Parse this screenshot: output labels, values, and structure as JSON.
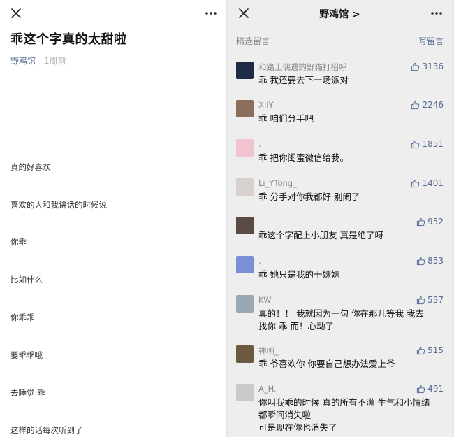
{
  "left": {
    "article_title": "乖这个字真的太甜啦",
    "author": "野鸡馆",
    "time": "1周前",
    "lines": [
      "真的好喜欢",
      "喜欢的人和我讲话的时候说",
      "你乖",
      "比如什么",
      "你乖乖",
      "要乖乖哦",
      "去睡觉 乖",
      "这样的话每次听到了"
    ]
  },
  "right": {
    "title": "野鸡馆 >",
    "section_label": "精选留言",
    "write_label": "写留言",
    "comments": [
      {
        "nick": "和路上偶遇的野猫打招呼",
        "text": "乖 我还要去下一场派对",
        "likes": "3136",
        "avatar_color": "#1f2a44"
      },
      {
        "nick": "XIIY",
        "text": "乖 咱们分手吧",
        "likes": "2246",
        "avatar_color": "#8b6f5c"
      },
      {
        "nick": ".",
        "text": "乖 把你闺蜜微信给我。",
        "likes": "1851",
        "avatar_color": "#f2c4cf"
      },
      {
        "nick": "Li_YTong_",
        "text": "乖 分手对你我都好 别闹了",
        "likes": "1401",
        "avatar_color": "#d8d0cc"
      },
      {
        "nick": "",
        "text": "乖这个字配上小朋友 真是绝了呀",
        "likes": "952",
        "avatar_color": "#5a4a45"
      },
      {
        "nick": ".",
        "text": "乖 她只是我的干妹妹",
        "likes": "853",
        "avatar_color": "#7b8fd6"
      },
      {
        "nick": "KW",
        "text": "真的！！ 我就因为一句 你在那儿等我 我去找你 乖 而！心动了",
        "likes": "537",
        "avatar_color": "#9aa8b4"
      },
      {
        "nick": "神明_",
        "text": "乖 爷喜欢你 你要自己想办法爱上爷",
        "likes": "515",
        "avatar_color": "#6b5a3e"
      },
      {
        "nick": "A_H.",
        "text": "你叫我乖的时候 真的所有不满 生气和小情绪都瞬间消失啦\n可是现在你也消失了",
        "likes": "491",
        "avatar_color": "#c9c9c9"
      }
    ]
  }
}
